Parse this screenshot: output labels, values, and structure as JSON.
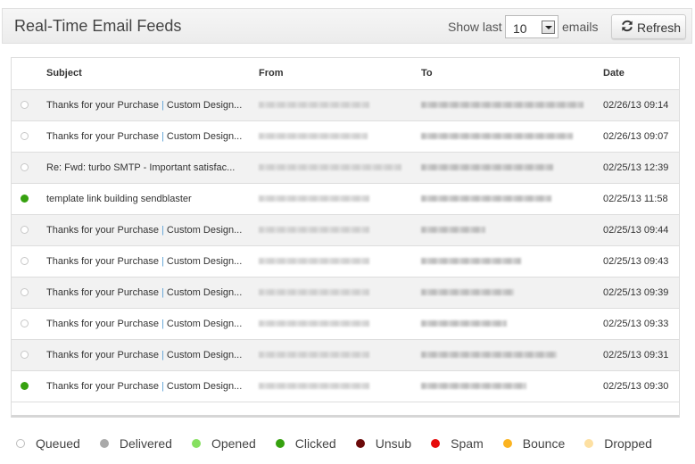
{
  "header": {
    "title": "Real-Time Email Feeds",
    "show_last_label": "Show last",
    "show_last_value": "10",
    "emails_label": "emails",
    "refresh_label": "Refresh"
  },
  "table": {
    "columns": [
      "",
      "Subject",
      "From",
      "To",
      "Date"
    ],
    "rows": [
      {
        "status": "queued",
        "subject_a": "Thanks for your Purchase ",
        "subject_b": " Custom Design...",
        "has_pipe": true,
        "from": "[blurred]",
        "to": "[blurred]",
        "date": "02/26/13 09:14"
      },
      {
        "status": "queued",
        "subject_a": "Thanks for your Purchase ",
        "subject_b": " Custom Design...",
        "has_pipe": true,
        "from": "[blurred]",
        "to": "[blurred]",
        "date": "02/26/13 09:07"
      },
      {
        "status": "queued",
        "subject_a": "Re: Fwd: turbo SMTP - Important satisfac...",
        "subject_b": "",
        "has_pipe": false,
        "from": "[blurred]",
        "to": "[blurred]",
        "date": "02/25/13 12:39"
      },
      {
        "status": "clicked",
        "subject_a": "template link building sendblaster",
        "subject_b": "",
        "has_pipe": false,
        "from": "[blurred]",
        "to": "[blurred]",
        "date": "02/25/13 11:58"
      },
      {
        "status": "queued",
        "subject_a": "Thanks for your Purchase ",
        "subject_b": " Custom Design...",
        "has_pipe": true,
        "from": "[blurred]",
        "to": "[blurred]",
        "date": "02/25/13 09:44"
      },
      {
        "status": "queued",
        "subject_a": "Thanks for your Purchase ",
        "subject_b": " Custom Design...",
        "has_pipe": true,
        "from": "[blurred]",
        "to": "[blurred]",
        "date": "02/25/13 09:43"
      },
      {
        "status": "queued",
        "subject_a": "Thanks for your Purchase ",
        "subject_b": " Custom Design...",
        "has_pipe": true,
        "from": "[blurred]",
        "to": "[blurred]",
        "date": "02/25/13 09:39"
      },
      {
        "status": "queued",
        "subject_a": "Thanks for your Purchase ",
        "subject_b": " Custom Design...",
        "has_pipe": true,
        "from": "[blurred]",
        "to": "[blurred]",
        "date": "02/25/13 09:33"
      },
      {
        "status": "queued",
        "subject_a": "Thanks for your Purchase ",
        "subject_b": " Custom Design...",
        "has_pipe": true,
        "from": "[blurred]",
        "to": "[blurred]",
        "date": "02/25/13 09:31"
      },
      {
        "status": "clicked",
        "subject_a": "Thanks for your Purchase ",
        "subject_b": " Custom Design...",
        "has_pipe": true,
        "from": "[blurred]",
        "to": "[blurred]",
        "date": "02/25/13 09:30"
      }
    ]
  },
  "legend": [
    {
      "label": "Queued",
      "color": "#ffffff",
      "border": "#bdbdbd"
    },
    {
      "label": "Delivered",
      "color": "#a9a9a9"
    },
    {
      "label": "Opened",
      "color": "#86e060"
    },
    {
      "label": "Clicked",
      "color": "#36a10f"
    },
    {
      "label": "Unsub",
      "color": "#6b0a0a"
    },
    {
      "label": "Spam",
      "color": "#e60b0b"
    },
    {
      "label": "Bounce",
      "color": "#fbb320"
    },
    {
      "label": "Dropped",
      "color": "#fde0a2"
    }
  ]
}
